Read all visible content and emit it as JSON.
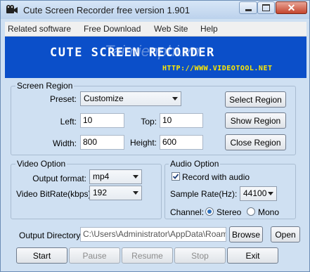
{
  "window": {
    "title": "Cute Screen Recorder free version 1.901"
  },
  "menu": [
    "Related software",
    "Free Download",
    "Web Site",
    "Help"
  ],
  "banner": {
    "title": "CUTE SCREEN RECORDER",
    "url": "HTTP://WWW.VIDEOTOOL.NET",
    "watermark": "Taimienphi.vn"
  },
  "screen_region": {
    "label": "Screen Region",
    "preset_label": "Preset:",
    "preset_value": "Customize",
    "left_label": "Left:",
    "left_value": "10",
    "top_label": "Top:",
    "top_value": "10",
    "width_label": "Width:",
    "width_value": "800",
    "height_label": "Height:",
    "height_value": "600",
    "select_region": "Select Region",
    "show_region": "Show Region",
    "close_region": "Close Region"
  },
  "video_option": {
    "label": "Video Option",
    "format_label": "Output format:",
    "format_value": "mp4",
    "bitrate_label": "Video BitRate(kbps):",
    "bitrate_value": "192"
  },
  "audio_option": {
    "label": "Audio Option",
    "record_label": "Record with audio",
    "record_checked": true,
    "sample_label": "Sample Rate(Hz):",
    "sample_value": "44100",
    "channel_label": "Channel:",
    "stereo_label": "Stereo",
    "mono_label": "Mono",
    "channel_selected": "Stereo"
  },
  "output": {
    "label": "Output Directory:",
    "path": "C:\\Users\\Administrator\\AppData\\Roaming",
    "browse": "Browse",
    "open": "Open"
  },
  "actions": {
    "start": "Start",
    "pause": "Pause",
    "resume": "Resume",
    "stop": "Stop",
    "exit": "Exit"
  },
  "colors": {
    "accent": "#0b4fc9",
    "banner_url": "#ffe800",
    "window_bg": "#cfe0f2"
  }
}
